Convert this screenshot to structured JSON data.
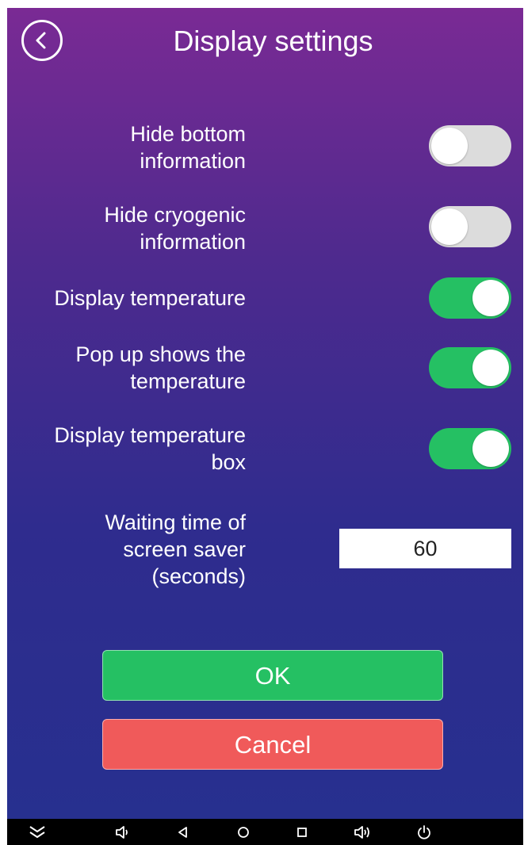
{
  "header": {
    "title": "Display settings",
    "back_icon": "chevron-left-circle-icon"
  },
  "settings": [
    {
      "label": "Hide bottom\ninformation",
      "state": "off"
    },
    {
      "label": "Hide cryogenic\ninformation",
      "state": "off"
    },
    {
      "label": "Display temperature",
      "state": "on"
    },
    {
      "label": "Pop up shows the\ntemperature",
      "state": "on"
    },
    {
      "label": "Display temperature\nbox",
      "state": "on"
    }
  ],
  "screen_saver": {
    "label": "Waiting time of\nscreen saver\n(seconds)",
    "value": "60"
  },
  "buttons": {
    "ok": "OK",
    "cancel": "Cancel"
  },
  "colors": {
    "toggle_on": "#25c063",
    "toggle_off": "#dcdcdc",
    "ok_button": "#25c063",
    "cancel_button": "#f05a5a",
    "background_top": "#7a2a94",
    "background_bottom": "#26308f"
  },
  "navbar": {
    "icons": [
      "collapse-chevrons-icon",
      "volume-down-icon",
      "nav-back-icon",
      "nav-home-icon",
      "nav-recents-icon",
      "volume-up-icon",
      "power-icon"
    ]
  }
}
